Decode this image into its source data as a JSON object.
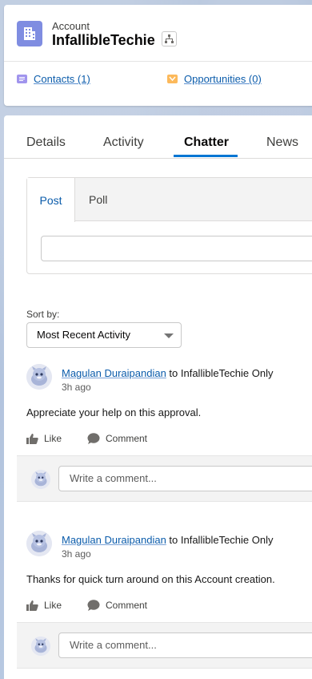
{
  "header": {
    "object_label": "Account",
    "record_name": "InfallibleTechie",
    "related": [
      {
        "label": "Contacts (1)",
        "icon": "contacts-icon",
        "color": "#a094ed"
      },
      {
        "label": "Opportunities (0)",
        "icon": "opportunities-icon",
        "color": "#fcb95b"
      }
    ]
  },
  "tabs": [
    {
      "label": "Details"
    },
    {
      "label": "Activity"
    },
    {
      "label": "Chatter",
      "active": true
    },
    {
      "label": "News"
    }
  ],
  "publisher": {
    "tabs": [
      {
        "label": "Post",
        "active": true
      },
      {
        "label": "Poll"
      }
    ],
    "input_placeholder": ""
  },
  "feed": {
    "sort_label": "Sort by:",
    "sort_value": "Most Recent Activity",
    "like_label": "Like",
    "comment_label": "Comment",
    "comment_placeholder": "Write a comment...",
    "posts": [
      {
        "author": "Magulan Duraipandian",
        "target": " to InfallibleTechie Only",
        "time": "3h ago",
        "body": "Appreciate your help on this approval."
      },
      {
        "author": "Magulan Duraipandian",
        "target": " to InfallibleTechie Only",
        "time": "3h ago",
        "body": "Thanks for quick turn around on this Account creation."
      }
    ]
  },
  "colors": {
    "accent": "#0176d3",
    "account_icon": "#7f8de1",
    "link": "#0b5cab"
  }
}
